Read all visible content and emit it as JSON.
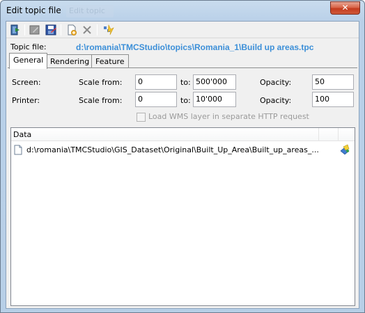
{
  "window": {
    "title": "Edit topic file",
    "ghost_title": "Edit topic"
  },
  "toolbar": {
    "buttons": [
      "exit-icon",
      "edit-icon",
      "save-icon",
      "new-file-icon",
      "delete-icon",
      "wizard-icon"
    ]
  },
  "topic_file": {
    "label": "Topic file:",
    "value": "d:\\romania\\TMCStudio\\topics\\Romania_1\\Build up areas.tpc"
  },
  "tabs": [
    {
      "label": "General",
      "active": true
    },
    {
      "label": "Rendering",
      "active": false
    },
    {
      "label": "Feature",
      "active": false
    }
  ],
  "general": {
    "screen": {
      "label": "Screen:",
      "scale_from_label": "Scale from:",
      "scale_from": "0",
      "to_label": "to:",
      "to": "500'000",
      "opacity_label": "Opacity:",
      "opacity": "50"
    },
    "printer": {
      "label": "Printer:",
      "scale_from_label": "Scale from:",
      "scale_from": "0",
      "to_label": "to:",
      "to": "10'000",
      "opacity_label": "Opacity:",
      "opacity": "100"
    },
    "wms_checkbox": {
      "label": "Load WMS layer in separate HTTP request",
      "checked": false,
      "enabled": false
    }
  },
  "data_list": {
    "column_header": "Data",
    "rows": [
      {
        "path": "d:\\romania\\TMCStudio\\GIS_Dataset\\Original\\Built_Up_Area\\Built_up_areas_..."
      }
    ]
  },
  "colors": {
    "accent_link": "#3c8fd8",
    "close_button": "#c43c1f"
  }
}
